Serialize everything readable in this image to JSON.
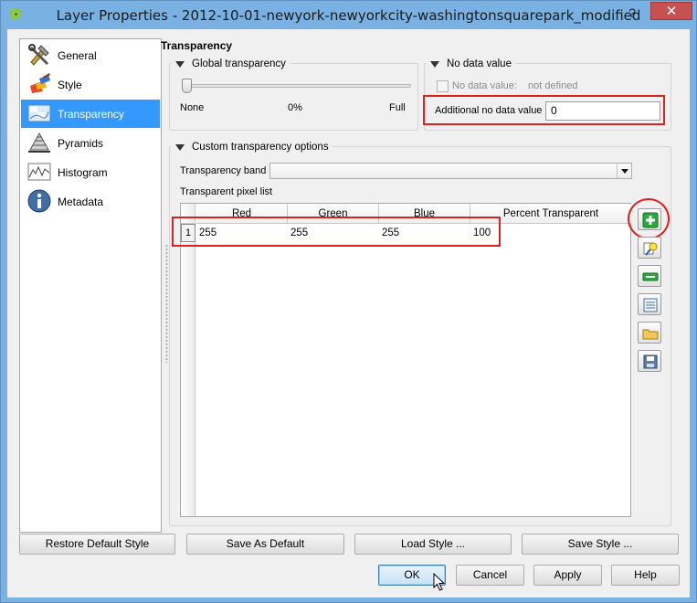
{
  "window": {
    "title": "Layer Properties - 2012-10-01-newyork-newyorkcity-washingtonsquarepark_modified",
    "help_glyph": "?",
    "close_glyph": "✕"
  },
  "nav": {
    "items": [
      {
        "label": "General",
        "icon": "tools-icon"
      },
      {
        "label": "Style",
        "icon": "paintbrush-icon"
      },
      {
        "label": "Transparency",
        "icon": "transparency-icon"
      },
      {
        "label": "Pyramids",
        "icon": "pyramid-icon"
      },
      {
        "label": "Histogram",
        "icon": "histogram-icon"
      },
      {
        "label": "Metadata",
        "icon": "info-icon"
      }
    ],
    "selected": "Transparency"
  },
  "transparency": {
    "section_title": "Transparency",
    "global": {
      "title": "Global transparency",
      "min_label": "None",
      "value_label": "0%",
      "max_label": "Full",
      "value_fraction": 0
    },
    "nodata": {
      "title": "No data value",
      "checkbox_label": "No data value:",
      "checkbox_value": "not defined",
      "additional_label": "Additional no data value",
      "additional_value": "0"
    },
    "custom": {
      "title": "Custom transparency options",
      "band_label": "Transparency band",
      "band_value": "",
      "list_label": "Transparent pixel list",
      "columns": [
        "Red",
        "Green",
        "Blue",
        "Percent Transparent"
      ],
      "rows": [
        {
          "index": "1",
          "red": "255",
          "green": "255",
          "blue": "255",
          "percent": "100"
        }
      ]
    },
    "side_buttons": [
      "add-value-icon",
      "pick-from-display-icon",
      "remove-value-icon",
      "default-values-icon",
      "import-file-icon",
      "export-file-icon"
    ]
  },
  "footer": {
    "restore_default": "Restore Default Style",
    "save_as_default": "Save As Default",
    "load_style": "Load Style ...",
    "save_style": "Save Style ...",
    "ok": "OK",
    "cancel": "Cancel",
    "apply": "Apply",
    "help": "Help"
  },
  "colors": {
    "titlebar": "#78b1e2",
    "selection": "#3399ff",
    "highlight": "#e0201c",
    "add_green": "#1f9a34"
  }
}
